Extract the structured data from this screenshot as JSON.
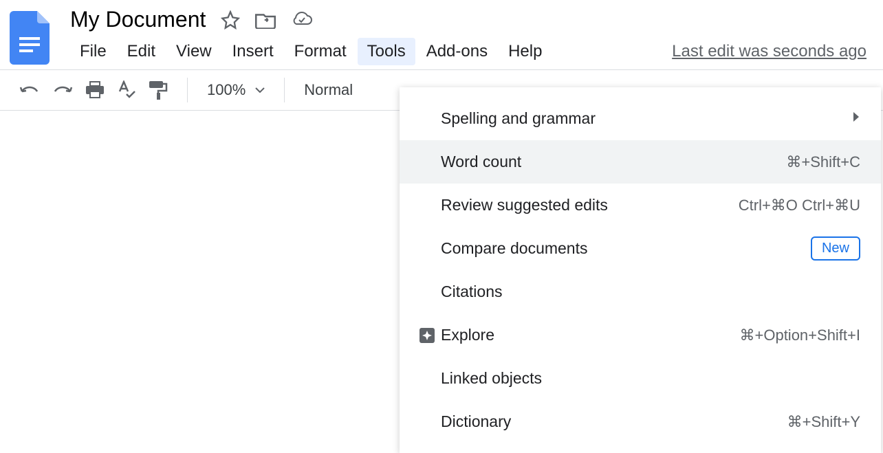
{
  "document": {
    "title": "My Document",
    "last_edit": "Last edit was seconds ago"
  },
  "menubar": {
    "file": "File",
    "edit": "Edit",
    "view": "View",
    "insert": "Insert",
    "format": "Format",
    "tools": "Tools",
    "addons": "Add-ons",
    "help": "Help"
  },
  "toolbar": {
    "zoom": "100%",
    "style": "Normal"
  },
  "tools_menu": {
    "spelling": {
      "label": "Spelling and grammar"
    },
    "word_count": {
      "label": "Word count",
      "shortcut": "⌘+Shift+C"
    },
    "review": {
      "label": "Review suggested edits",
      "shortcut": "Ctrl+⌘O Ctrl+⌘U"
    },
    "compare": {
      "label": "Compare documents",
      "badge": "New"
    },
    "citations": {
      "label": "Citations"
    },
    "explore": {
      "label": "Explore",
      "shortcut": "⌘+Option+Shift+I"
    },
    "linked": {
      "label": "Linked objects"
    },
    "dictionary": {
      "label": "Dictionary",
      "shortcut": "⌘+Shift+Y"
    }
  }
}
